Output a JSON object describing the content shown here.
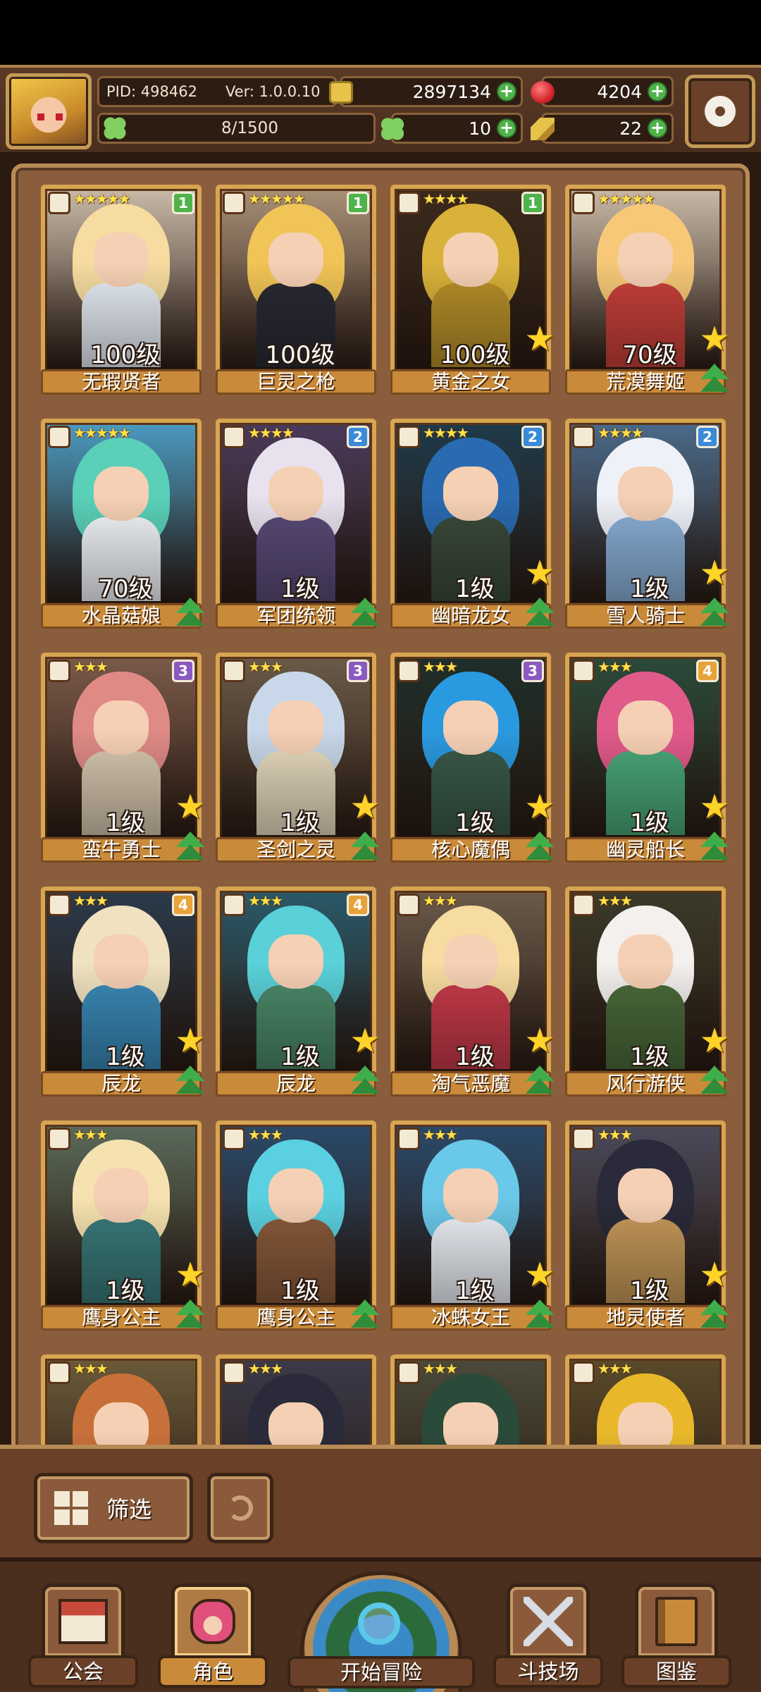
{
  "header": {
    "pid": "PID: 498462",
    "version": "Ver: 1.0.0.10",
    "level_progress": "8/1500",
    "gold": "2897134",
    "gems": "4204",
    "clovers": "10",
    "feathers": "22"
  },
  "cards": [
    {
      "name": "无瑕贤者",
      "level": "100级",
      "stars": "★★★★★",
      "badge": "1",
      "badge_color": "#4fb34a",
      "hair": "#f6dca0",
      "body": "#e8eef6",
      "bg": "#c9b9a8",
      "show_star": false,
      "show_up": false
    },
    {
      "name": "巨灵之枪",
      "level": "100级",
      "stars": "★★★★★",
      "badge": "1",
      "badge_color": "#4fb34a",
      "hair": "#f0c456",
      "body": "#2a2a34",
      "bg": "#a89078",
      "show_star": false,
      "show_up": false
    },
    {
      "name": "黄金之女",
      "level": "100级",
      "stars": "★★★★",
      "badge": "1",
      "badge_color": "#4fb34a",
      "hair": "#d8b23a",
      "body": "#b8902a",
      "bg": "#3a2a1c",
      "show_star": true,
      "show_up": false
    },
    {
      "name": "荒漠舞姬",
      "level": "70级",
      "stars": "★★★★★",
      "badge": "",
      "badge_color": "",
      "hair": "#f6c878",
      "body": "#c8403a",
      "bg": "#c9b9a8",
      "show_star": true,
      "show_up": true
    },
    {
      "name": "水晶菇娘",
      "level": "70级",
      "stars": "★★★★★",
      "badge": "",
      "badge_color": "",
      "hair": "#5ad0b8",
      "body": "#f3f6fa",
      "bg": "#4a9ac0",
      "show_star": false,
      "show_up": true
    },
    {
      "name": "军团统领",
      "level": "1级",
      "stars": "★★★★",
      "badge": "2",
      "badge_color": "#3a8ad8",
      "hair": "#e8e2ee",
      "body": "#5a4a78",
      "bg": "#4a3a5a",
      "show_star": false,
      "show_up": true
    },
    {
      "name": "幽暗龙女",
      "level": "1级",
      "stars": "★★★★",
      "badge": "2",
      "badge_color": "#3a8ad8",
      "hair": "#2a6ab0",
      "body": "#3a4a3a",
      "bg": "#1e3a4a",
      "show_star": true,
      "show_up": true
    },
    {
      "name": "雪人骑士",
      "level": "1级",
      "stars": "★★★★",
      "badge": "2",
      "badge_color": "#3a8ad8",
      "hair": "#eef2f8",
      "body": "#8ab0d8",
      "bg": "#4a6a8a",
      "show_star": true,
      "show_up": true
    },
    {
      "name": "蛮牛勇士",
      "level": "1级",
      "stars": "★★★",
      "badge": "3",
      "badge_color": "#8a5ac0",
      "hair": "#e08a86",
      "body": "#d8c8b0",
      "bg": "#7a5a4a",
      "show_star": true,
      "show_up": true
    },
    {
      "name": "圣剑之灵",
      "level": "1级",
      "stars": "★★★",
      "badge": "3",
      "badge_color": "#8a5ac0",
      "hair": "#c8d8ea",
      "body": "#e8dcc0",
      "bg": "#6a5a48",
      "show_star": true,
      "show_up": true
    },
    {
      "name": "核心魔偶",
      "level": "1级",
      "stars": "★★★",
      "badge": "3",
      "badge_color": "#8a5ac0",
      "hair": "#2a9ae0",
      "body": "#3a5a4a",
      "bg": "#1e2e2a",
      "show_star": true,
      "show_up": true
    },
    {
      "name": "幽灵船长",
      "level": "1级",
      "stars": "★★★",
      "badge": "4",
      "badge_color": "#e8a23a",
      "hair": "#e05a8a",
      "body": "#4aa878",
      "bg": "#2a4a3a",
      "show_star": true,
      "show_up": true
    },
    {
      "name": "辰龙",
      "level": "1级",
      "stars": "★★★",
      "badge": "4",
      "badge_color": "#e8a23a",
      "hair": "#f0e2c0",
      "body": "#3a8ab8",
      "bg": "#2a3a4a",
      "show_star": true,
      "show_up": true
    },
    {
      "name": "辰龙",
      "level": "1级",
      "stars": "★★★",
      "badge": "4",
      "badge_color": "#e8a23a",
      "hair": "#5ad0d8",
      "body": "#4a8a6a",
      "bg": "#2a5a6a",
      "show_star": true,
      "show_up": true
    },
    {
      "name": "淘气恶魔",
      "level": "1级",
      "stars": "★★★",
      "badge": "",
      "badge_color": "",
      "hair": "#f6dca0",
      "body": "#c83a4a",
      "bg": "#6a5a4a",
      "show_star": true,
      "show_up": true
    },
    {
      "name": "风行游侠",
      "level": "1级",
      "stars": "★★★",
      "badge": "",
      "badge_color": "",
      "hair": "#f3f0ee",
      "body": "#4a6a3a",
      "bg": "#3a3a2a",
      "show_star": true,
      "show_up": true
    },
    {
      "name": "鹰身公主",
      "level": "1级",
      "stars": "★★★",
      "badge": "",
      "badge_color": "",
      "hair": "#f6e2b0",
      "body": "#3a7a7a",
      "bg": "#5a6a5a",
      "show_star": true,
      "show_up": true
    },
    {
      "name": "鹰身公主",
      "level": "1级",
      "stars": "★★★",
      "badge": "",
      "badge_color": "",
      "hair": "#5ad0e0",
      "body": "#8a5a3a",
      "bg": "#2a4a6a",
      "show_star": false,
      "show_up": true
    },
    {
      "name": "冰蛛女王",
      "level": "1级",
      "stars": "★★★",
      "badge": "",
      "badge_color": "",
      "hair": "#6ac8e8",
      "body": "#eef2f8",
      "bg": "#2a4a6a",
      "show_star": true,
      "show_up": true
    },
    {
      "name": "地灵使者",
      "level": "1级",
      "stars": "★★★",
      "badge": "",
      "badge_color": "",
      "hair": "#2a2a3a",
      "body": "#c89a5a",
      "bg": "#4a4a5a",
      "show_star": true,
      "show_up": true
    },
    {
      "name": "",
      "level": "",
      "stars": "★★★",
      "badge": "",
      "badge_color": "",
      "hair": "#c8703a",
      "body": "#a85a3a",
      "bg": "#6a5a3a",
      "show_star": false,
      "show_up": false
    },
    {
      "name": "",
      "level": "",
      "stars": "★★★",
      "badge": "",
      "badge_color": "",
      "hair": "#2a2a3a",
      "body": "#eeeeee",
      "bg": "#3a3a4a",
      "show_star": false,
      "show_up": false
    },
    {
      "name": "",
      "level": "",
      "stars": "★★★",
      "badge": "",
      "badge_color": "",
      "hair": "#2a4a3a",
      "body": "#4a8a7a",
      "bg": "#4a4a3a",
      "show_star": false,
      "show_up": false
    },
    {
      "name": "",
      "level": "",
      "stars": "★★★",
      "badge": "",
      "badge_color": "",
      "hair": "#e8b82a",
      "body": "#e8b82a",
      "bg": "#5a4a2a",
      "show_star": false,
      "show_up": false
    }
  ],
  "filter": {
    "label": "筛选"
  },
  "nav": [
    {
      "label": "公会",
      "icon": "guild-icon",
      "active": false
    },
    {
      "label": "角色",
      "icon": "character-icon",
      "active": true
    },
    {
      "label": "开始冒险",
      "icon": "adventure-globe-icon",
      "active": false
    },
    {
      "label": "斗技场",
      "icon": "arena-swords-icon",
      "active": false
    },
    {
      "label": "图鉴",
      "icon": "codex-book-icon",
      "active": false
    }
  ]
}
